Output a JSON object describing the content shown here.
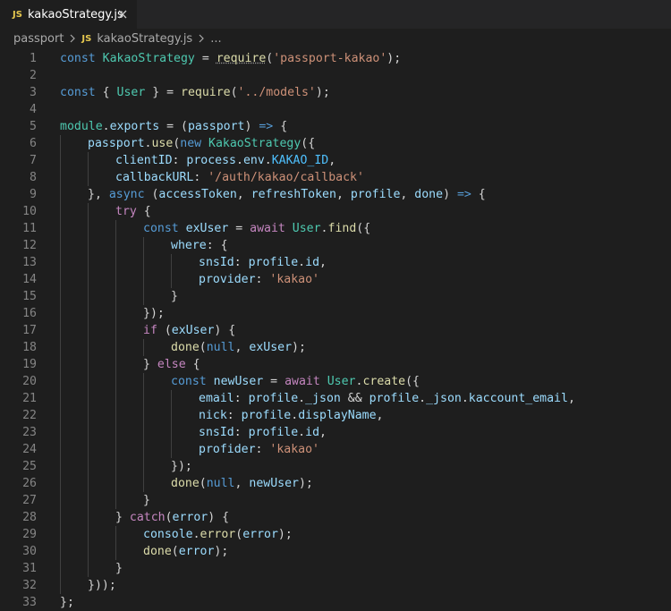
{
  "tab": {
    "badge": "JS",
    "title": "kakaoStrategy.js"
  },
  "breadcrumb": {
    "folder": "passport",
    "badge": "JS",
    "file": "kakaoStrategy.js",
    "more": "..."
  },
  "code": [
    {
      "n": "1",
      "indent": 0,
      "tokens": [
        [
          "kw",
          "const"
        ],
        [
          "pl",
          " "
        ],
        [
          "cls",
          "KakaoStrategy"
        ],
        [
          "pl",
          " = "
        ],
        [
          "fn",
          "require"
        ],
        [
          "pl",
          "("
        ],
        [
          "str",
          "'passport-kakao'"
        ],
        [
          "pl",
          ");"
        ]
      ]
    },
    {
      "n": "2",
      "indent": 0,
      "tokens": []
    },
    {
      "n": "3",
      "indent": 0,
      "tokens": [
        [
          "kw",
          "const"
        ],
        [
          "pl",
          " { "
        ],
        [
          "cls",
          "User"
        ],
        [
          "pl",
          " } = "
        ],
        [
          "fn",
          "require"
        ],
        [
          "pl",
          "("
        ],
        [
          "str",
          "'../models'"
        ],
        [
          "pl",
          ");"
        ]
      ]
    },
    {
      "n": "4",
      "indent": 0,
      "tokens": []
    },
    {
      "n": "5",
      "indent": 0,
      "tokens": [
        [
          "cls",
          "module"
        ],
        [
          "pl",
          "."
        ],
        [
          "var",
          "exports"
        ],
        [
          "pl",
          " = ("
        ],
        [
          "var",
          "passport"
        ],
        [
          "pl",
          ") "
        ],
        [
          "kw",
          "=>"
        ],
        [
          "pl",
          " {"
        ]
      ]
    },
    {
      "n": "6",
      "indent": 1,
      "tokens": [
        [
          "var",
          "passport"
        ],
        [
          "pl",
          "."
        ],
        [
          "fn",
          "use"
        ],
        [
          "pl",
          "("
        ],
        [
          "kw",
          "new"
        ],
        [
          "pl",
          " "
        ],
        [
          "cls",
          "KakaoStrategy"
        ],
        [
          "pl",
          "({"
        ]
      ]
    },
    {
      "n": "7",
      "indent": 2,
      "tokens": [
        [
          "var",
          "clientID"
        ],
        [
          "pl",
          ": "
        ],
        [
          "var",
          "process"
        ],
        [
          "pl",
          "."
        ],
        [
          "var",
          "env"
        ],
        [
          "pl",
          "."
        ],
        [
          "cnst",
          "KAKAO_ID"
        ],
        [
          "pl",
          ","
        ]
      ]
    },
    {
      "n": "8",
      "indent": 2,
      "tokens": [
        [
          "var",
          "callbackURL"
        ],
        [
          "pl",
          ": "
        ],
        [
          "str",
          "'/auth/kakao/callback'"
        ]
      ]
    },
    {
      "n": "9",
      "indent": 1,
      "tokens": [
        [
          "pl",
          "}, "
        ],
        [
          "kw",
          "async"
        ],
        [
          "pl",
          " ("
        ],
        [
          "var",
          "accessToken"
        ],
        [
          "pl",
          ", "
        ],
        [
          "var",
          "refreshToken"
        ],
        [
          "pl",
          ", "
        ],
        [
          "var",
          "profile"
        ],
        [
          "pl",
          ", "
        ],
        [
          "var",
          "done"
        ],
        [
          "pl",
          ") "
        ],
        [
          "kw",
          "=>"
        ],
        [
          "pl",
          " {"
        ]
      ]
    },
    {
      "n": "10",
      "indent": 2,
      "tokens": [
        [
          "kc",
          "try"
        ],
        [
          "pl",
          " {"
        ]
      ]
    },
    {
      "n": "11",
      "indent": 3,
      "tokens": [
        [
          "kw",
          "const"
        ],
        [
          "pl",
          " "
        ],
        [
          "var",
          "exUser"
        ],
        [
          "pl",
          " = "
        ],
        [
          "kc",
          "await"
        ],
        [
          "pl",
          " "
        ],
        [
          "cls",
          "User"
        ],
        [
          "pl",
          "."
        ],
        [
          "fn",
          "find"
        ],
        [
          "pl",
          "({"
        ]
      ]
    },
    {
      "n": "12",
      "indent": 4,
      "tokens": [
        [
          "var",
          "where"
        ],
        [
          "pl",
          ": {"
        ]
      ]
    },
    {
      "n": "13",
      "indent": 5,
      "tokens": [
        [
          "var",
          "snsId"
        ],
        [
          "pl",
          ": "
        ],
        [
          "var",
          "profile"
        ],
        [
          "pl",
          "."
        ],
        [
          "var",
          "id"
        ],
        [
          "pl",
          ","
        ]
      ]
    },
    {
      "n": "14",
      "indent": 5,
      "tokens": [
        [
          "var",
          "provider"
        ],
        [
          "pl",
          ": "
        ],
        [
          "str",
          "'kakao'"
        ]
      ]
    },
    {
      "n": "15",
      "indent": 4,
      "tokens": [
        [
          "pl",
          "}"
        ]
      ]
    },
    {
      "n": "16",
      "indent": 3,
      "tokens": [
        [
          "pl",
          "});"
        ]
      ]
    },
    {
      "n": "17",
      "indent": 3,
      "tokens": [
        [
          "kc",
          "if"
        ],
        [
          "pl",
          " ("
        ],
        [
          "var",
          "exUser"
        ],
        [
          "pl",
          ") {"
        ]
      ]
    },
    {
      "n": "18",
      "indent": 4,
      "tokens": [
        [
          "fn",
          "done"
        ],
        [
          "pl",
          "("
        ],
        [
          "kw",
          "null"
        ],
        [
          "pl",
          ", "
        ],
        [
          "var",
          "exUser"
        ],
        [
          "pl",
          ");"
        ]
      ]
    },
    {
      "n": "19",
      "indent": 3,
      "tokens": [
        [
          "pl",
          "} "
        ],
        [
          "kc",
          "else"
        ],
        [
          "pl",
          " {"
        ]
      ]
    },
    {
      "n": "20",
      "indent": 4,
      "tokens": [
        [
          "kw",
          "const"
        ],
        [
          "pl",
          " "
        ],
        [
          "var",
          "newUser"
        ],
        [
          "pl",
          " = "
        ],
        [
          "kc",
          "await"
        ],
        [
          "pl",
          " "
        ],
        [
          "cls",
          "User"
        ],
        [
          "pl",
          "."
        ],
        [
          "fn",
          "create"
        ],
        [
          "pl",
          "({"
        ]
      ]
    },
    {
      "n": "21",
      "indent": 5,
      "tokens": [
        [
          "var",
          "email"
        ],
        [
          "pl",
          ": "
        ],
        [
          "var",
          "profile"
        ],
        [
          "pl",
          "."
        ],
        [
          "var",
          "_json"
        ],
        [
          "pl",
          " && "
        ],
        [
          "var",
          "profile"
        ],
        [
          "pl",
          "."
        ],
        [
          "var",
          "_json"
        ],
        [
          "pl",
          "."
        ],
        [
          "var",
          "kaccount_email"
        ],
        [
          "pl",
          ","
        ]
      ]
    },
    {
      "n": "22",
      "indent": 5,
      "tokens": [
        [
          "var",
          "nick"
        ],
        [
          "pl",
          ": "
        ],
        [
          "var",
          "profile"
        ],
        [
          "pl",
          "."
        ],
        [
          "var",
          "displayName"
        ],
        [
          "pl",
          ","
        ]
      ]
    },
    {
      "n": "23",
      "indent": 5,
      "tokens": [
        [
          "var",
          "snsId"
        ],
        [
          "pl",
          ": "
        ],
        [
          "var",
          "profile"
        ],
        [
          "pl",
          "."
        ],
        [
          "var",
          "id"
        ],
        [
          "pl",
          ","
        ]
      ]
    },
    {
      "n": "24",
      "indent": 5,
      "tokens": [
        [
          "var",
          "profider"
        ],
        [
          "pl",
          ": "
        ],
        [
          "str",
          "'kakao'"
        ]
      ]
    },
    {
      "n": "25",
      "indent": 4,
      "tokens": [
        [
          "pl",
          "});"
        ]
      ]
    },
    {
      "n": "26",
      "indent": 4,
      "tokens": [
        [
          "fn",
          "done"
        ],
        [
          "pl",
          "("
        ],
        [
          "kw",
          "null"
        ],
        [
          "pl",
          ", "
        ],
        [
          "var",
          "newUser"
        ],
        [
          "pl",
          ");"
        ]
      ]
    },
    {
      "n": "27",
      "indent": 3,
      "tokens": [
        [
          "pl",
          "}"
        ]
      ]
    },
    {
      "n": "28",
      "indent": 2,
      "tokens": [
        [
          "pl",
          "} "
        ],
        [
          "kc",
          "catch"
        ],
        [
          "pl",
          "("
        ],
        [
          "var",
          "error"
        ],
        [
          "pl",
          ") {"
        ]
      ]
    },
    {
      "n": "29",
      "indent": 3,
      "tokens": [
        [
          "var",
          "console"
        ],
        [
          "pl",
          "."
        ],
        [
          "fn",
          "error"
        ],
        [
          "pl",
          "("
        ],
        [
          "var",
          "error"
        ],
        [
          "pl",
          ");"
        ]
      ]
    },
    {
      "n": "30",
      "indent": 3,
      "tokens": [
        [
          "fn",
          "done"
        ],
        [
          "pl",
          "("
        ],
        [
          "var",
          "error"
        ],
        [
          "pl",
          ");"
        ]
      ]
    },
    {
      "n": "31",
      "indent": 2,
      "tokens": [
        [
          "pl",
          "}"
        ]
      ]
    },
    {
      "n": "32",
      "indent": 1,
      "tokens": [
        [
          "pl",
          "}));"
        ]
      ]
    },
    {
      "n": "33",
      "indent": 0,
      "tokens": [
        [
          "pl",
          "};"
        ]
      ]
    }
  ]
}
